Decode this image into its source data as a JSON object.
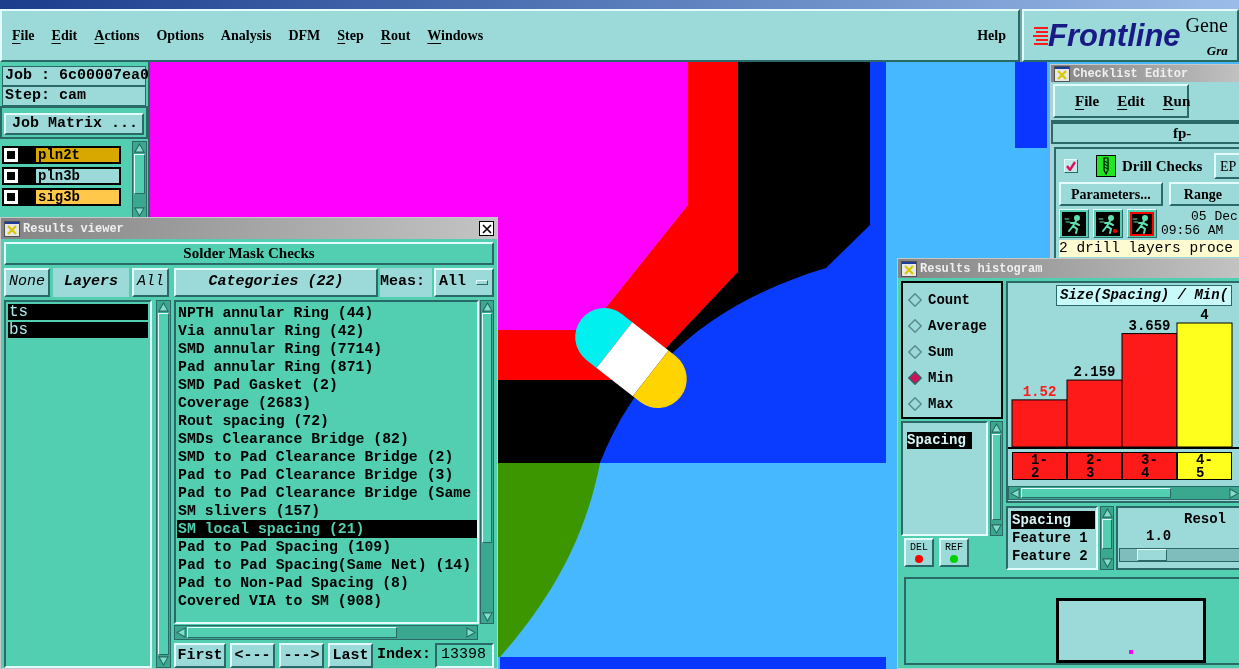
{
  "menu_bar": {
    "items": [
      {
        "label": "File",
        "underlined": true
      },
      {
        "label": "Edit",
        "underlined": true
      },
      {
        "label": "Actions",
        "underlined": true
      },
      {
        "label": "Options",
        "underlined": false
      },
      {
        "label": "Analysis",
        "underlined": false
      },
      {
        "label": "DFM",
        "underlined": false
      },
      {
        "label": "Step",
        "underlined": true
      },
      {
        "label": "Rout",
        "underlined": true
      },
      {
        "label": "Windows",
        "underlined": true
      }
    ],
    "help": {
      "label": "Help",
      "underlined": false
    }
  },
  "logo": {
    "brand": "Frontline",
    "product": "Gene",
    "subtitle": "Gra"
  },
  "job_panel": {
    "job": "Job : 6c00007ea0",
    "step": "Step: cam",
    "matrix_button": "Job Matrix ..."
  },
  "layers": [
    {
      "name": "pln2t",
      "color": "#d9a800",
      "checked": false
    },
    {
      "name": "pln3b",
      "color": "#9cdada",
      "checked": false
    },
    {
      "name": "sig3b",
      "color": "#ffc84a",
      "checked": false
    }
  ],
  "results_viewer": {
    "title": "Results viewer",
    "heading": "Solder Mask Checks",
    "layer_buttons": [
      {
        "label": "None",
        "kind": "button"
      },
      {
        "label": "Layers",
        "kind": "title"
      },
      {
        "label": "All",
        "kind": "button"
      }
    ],
    "layers": [
      {
        "name": "ts",
        "selected": true
      },
      {
        "name": "bs",
        "selected": true
      }
    ],
    "categories_button": "Categories (22)",
    "meas_label": "Meas:",
    "meas_value": "All",
    "categories": [
      {
        "label": "NPTH annular Ring (44)",
        "selected": false
      },
      {
        "label": "Via annular Ring (42)",
        "selected": false
      },
      {
        "label": "SMD annular Ring (7714)",
        "selected": false
      },
      {
        "label": "Pad annular Ring (871)",
        "selected": false
      },
      {
        "label": "SMD Pad Gasket (2)",
        "selected": false
      },
      {
        "label": "Coverage (2683)",
        "selected": false
      },
      {
        "label": "Rout spacing (72)",
        "selected": false
      },
      {
        "label": "SMDs Clearance Bridge (82)",
        "selected": false
      },
      {
        "label": "SMD to Pad Clearance Bridge (2)",
        "selected": false
      },
      {
        "label": "Pad to Pad Clearance Bridge (3)",
        "selected": false
      },
      {
        "label": "Pad to Pad Clearance Bridge (Same",
        "selected": false
      },
      {
        "label": "SM slivers (157)",
        "selected": false
      },
      {
        "label": "SM local spacing (21)",
        "selected": true
      },
      {
        "label": "Pad to Pad Spacing (109)",
        "selected": false
      },
      {
        "label": "Pad to Pad Spacing(Same Net) (14)",
        "selected": false
      },
      {
        "label": "Pad to Non-Pad Spacing (8)",
        "selected": false
      },
      {
        "label": "Covered VIA to SM (908)",
        "selected": false
      }
    ],
    "nav_buttons": [
      "First",
      "<---",
      "--->",
      "Last"
    ],
    "index_label": "Index:",
    "index_value": "13398"
  },
  "checklist_editor": {
    "title": "Checklist Editor",
    "menu": [
      {
        "label": "File",
        "underlined": true
      },
      {
        "label": "Edit",
        "underlined": true
      },
      {
        "label": "Run",
        "underlined": true
      }
    ],
    "checklist_name": "fp-",
    "check": {
      "checked": true,
      "label": "Drill Checks"
    },
    "ep_button": "EP",
    "parameters_button": "Parameters...",
    "range_button": "Range",
    "date": "05 Dec",
    "time": "09:56 AM",
    "status": "2 drill layers proce"
  },
  "histogram": {
    "title": "Results histogram",
    "modes": [
      {
        "label": "Count",
        "selected": false
      },
      {
        "label": "Average",
        "selected": false
      },
      {
        "label": "Sum",
        "selected": false
      },
      {
        "label": "Min",
        "selected": true
      },
      {
        "label": "Max",
        "selected": false
      }
    ],
    "measures": [
      {
        "label": "Spacing",
        "selected": true
      }
    ],
    "del_button": "DEL",
    "ref_button": "REF",
    "chart_data": {
      "type": "bar",
      "title": "Size(Spacing) / Min(",
      "categories": [
        "1-2",
        "2-3",
        "3-4",
        "4-5"
      ],
      "values": [
        1.52,
        2.159,
        3.659,
        4
      ],
      "data_labels": true
    },
    "bins": [
      {
        "selected": false,
        "flagged": true
      },
      {
        "selected": false,
        "flagged": false
      },
      {
        "selected": false,
        "flagged": false
      },
      {
        "selected": true,
        "flagged": false
      }
    ],
    "features": [
      {
        "label": "Spacing",
        "selected": true
      },
      {
        "label": "Feature 1",
        "selected": false
      },
      {
        "label": "Feature 2",
        "selected": false
      }
    ],
    "resolution": {
      "label": "Resol",
      "value": "1.0",
      "level": 0.2
    }
  }
}
